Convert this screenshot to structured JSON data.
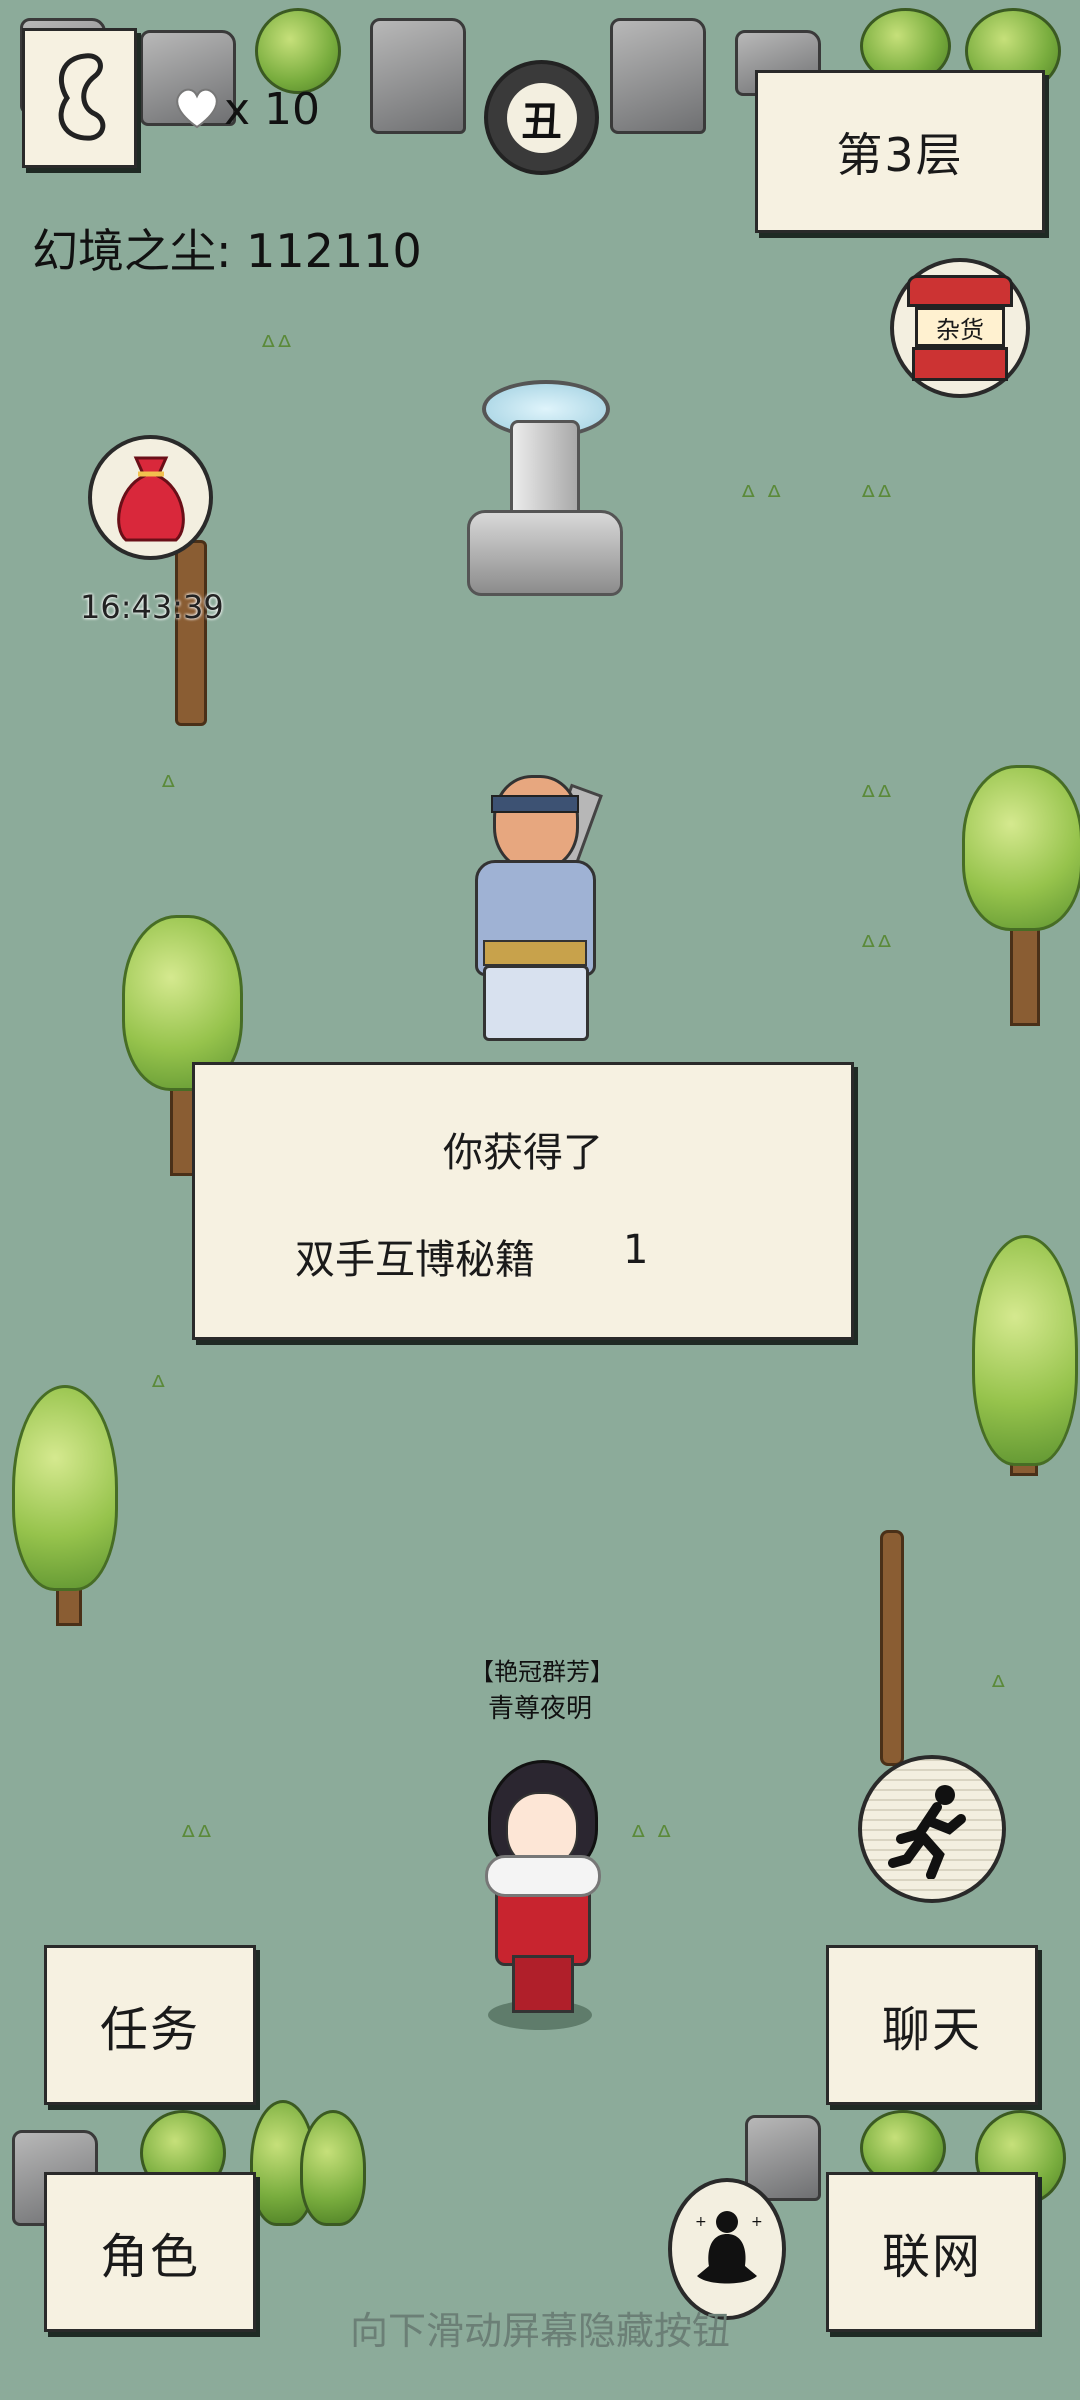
{
  "hud": {
    "lives": "x 10",
    "currency_label": "幻境之尘: 112110",
    "floor": "第3层",
    "timer": "16:43:39",
    "round_badge": "丑",
    "shop_sign": "杂货"
  },
  "dialog": {
    "title": "你获得了",
    "item_name": "双手互博秘籍",
    "item_count": "1"
  },
  "player": {
    "title": "【艳冠群芳】",
    "name": "青尊夜明"
  },
  "buttons": {
    "quest": "任务",
    "character": "角色",
    "chat": "聊天",
    "network": "联网"
  },
  "footer_hint": "向下滑动屏幕隐藏按钮"
}
